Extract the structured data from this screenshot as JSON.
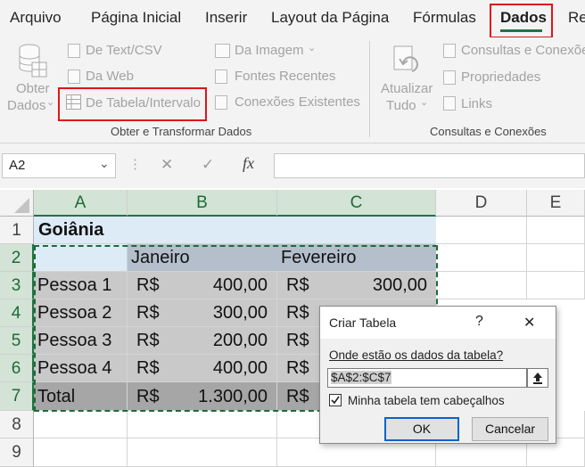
{
  "menu": {
    "items": [
      "Arquivo",
      "Página Inicial",
      "Inserir",
      "Layout da Página",
      "Fórmulas",
      "Dados",
      "Re"
    ],
    "active": "Dados"
  },
  "ribbon": {
    "obter_dados": [
      "Obter",
      "Dados"
    ],
    "de_texto_csv": "De Text/CSV",
    "da_web": "Da Web",
    "de_tabela": "De Tabela/Intervalo",
    "da_imagem": "Da Imagem",
    "fontes_recentes": "Fontes Recentes",
    "conexoes_existentes": "Conexões Existentes",
    "group_obter": "Obter e Transformar Dados",
    "atualizar_tudo": [
      "Atualizar",
      "Tudo"
    ],
    "consultas_conexoes_btn": "Consultas e Conexões",
    "propriedades": "Propriedades",
    "links": "Links",
    "group_consultas": "Consultas e Conexões"
  },
  "formula_bar": {
    "name_box": "A2",
    "cancel_glyph": "✕",
    "enter_glyph": "✓",
    "fx_label": "fx",
    "formula": ""
  },
  "columns": [
    "A",
    "B",
    "C",
    "D",
    "E"
  ],
  "rows": [
    "1",
    "2",
    "3",
    "4",
    "5",
    "6",
    "7",
    "8",
    "9"
  ],
  "sheet": {
    "title": "Goiânia",
    "header_b": "Janeiro",
    "header_c": "Fevereiro",
    "currency": "R$",
    "data": [
      {
        "label": "Pessoa 1",
        "jan": "400,00",
        "fev": "300,00"
      },
      {
        "label": "Pessoa 2",
        "jan": "300,00",
        "fev": ""
      },
      {
        "label": "Pessoa 3",
        "jan": "200,00",
        "fev": ""
      },
      {
        "label": "Pessoa 4",
        "jan": "400,00",
        "fev": ""
      },
      {
        "label": "Total",
        "jan": "1.300,00",
        "fev": ""
      }
    ]
  },
  "dialog": {
    "title": "Criar Tabela",
    "help": "?",
    "close": "✕",
    "prompt": "Onde estão os dados da tabela?",
    "range": "$A$2:$C$7",
    "checkbox_label": "Minha tabela tem cabeçalhos",
    "checkbox_checked": true,
    "ok": "OK",
    "cancel": "Cancelar"
  },
  "colors": {
    "accent_green": "#217346",
    "highlight_red": "#e0141c",
    "title_fill": "#ddebf7",
    "header_fill": "#b4bfcb",
    "data_fill": "#c9c9c9",
    "total_fill": "#a6a6a6"
  }
}
